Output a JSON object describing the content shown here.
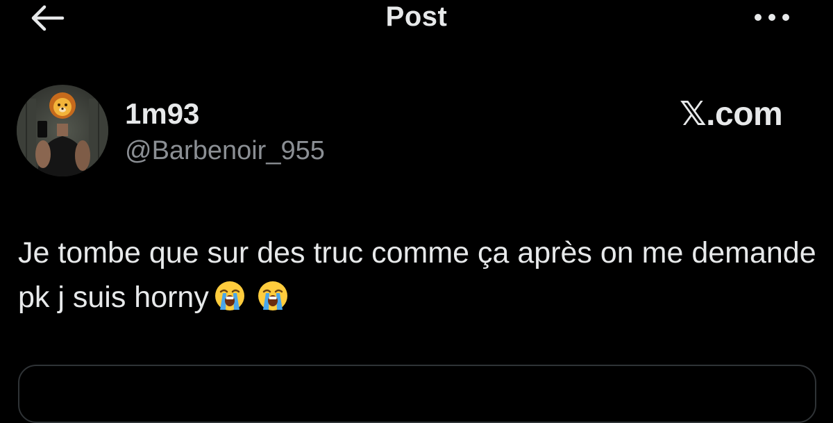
{
  "header": {
    "title": "Post",
    "back_icon": "arrow-left-icon",
    "more_icon": "more-horizontal-icon"
  },
  "author": {
    "display_name": "1m93",
    "handle": "@Barbenoir_955",
    "avatar_icon": "lion-emoji-face-icon"
  },
  "watermark": "𝕏.com",
  "post": {
    "text": "Je tombe que sur des truc comme ça après on me demande pk j suis horny",
    "emojis": [
      "loudly-crying-face-icon",
      "loudly-crying-face-icon"
    ]
  },
  "colors": {
    "background": "#000000",
    "text_primary": "#e7e9ea",
    "text_secondary": "#8b8f94",
    "border": "#2f3336"
  }
}
